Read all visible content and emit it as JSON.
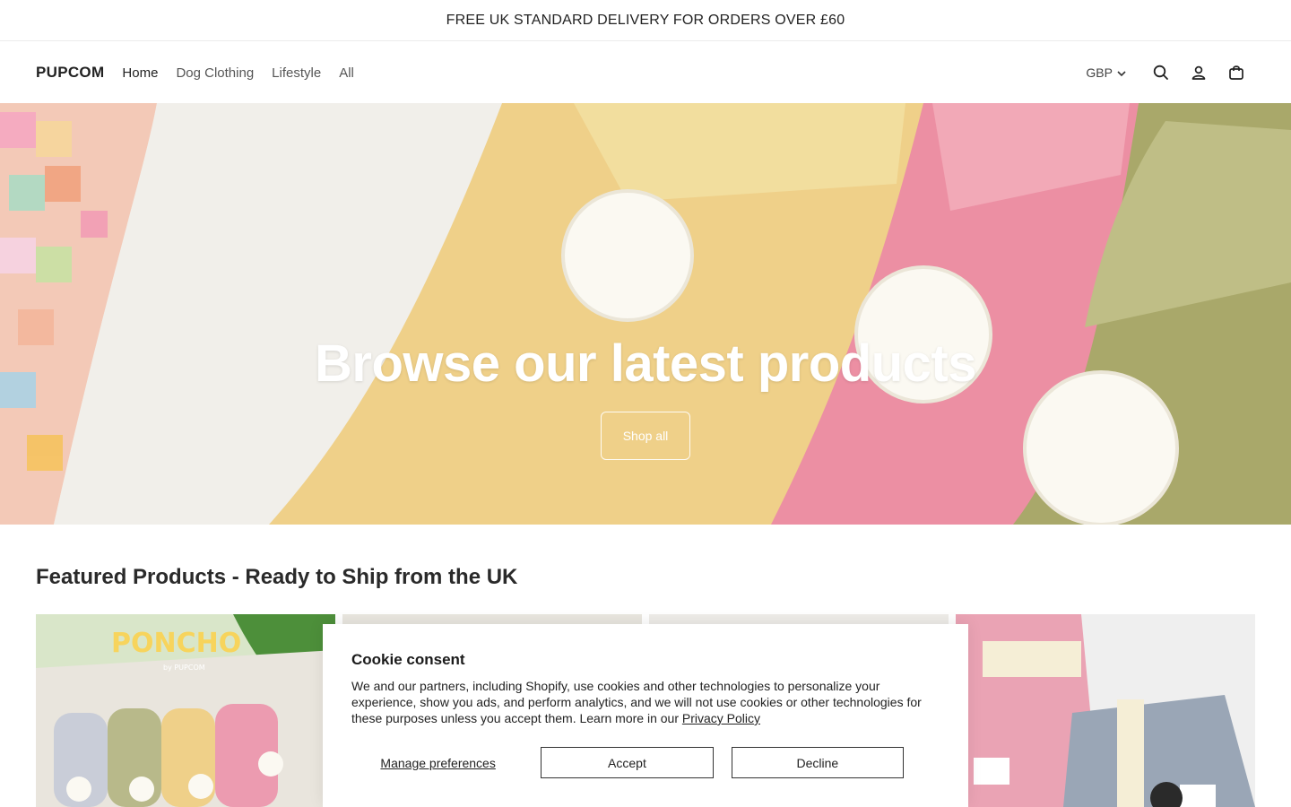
{
  "announcement": "FREE UK STANDARD DELIVERY FOR ORDERS OVER £60",
  "header": {
    "logo": "PUPCOM",
    "nav": [
      "Home",
      "Dog Clothing",
      "Lifestyle",
      "All"
    ],
    "currency": "GBP",
    "icons": [
      "search-icon",
      "account-icon",
      "cart-icon"
    ]
  },
  "hero": {
    "title": "Browse our latest products",
    "button": "Shop all"
  },
  "featured": {
    "title": "Featured Products - Ready to Ship from the UK",
    "product_images": [
      {
        "alt": "Poncho by Pupcom knitted scarves",
        "label_logo": "PONCHO",
        "label_small": "by PUPCOM"
      },
      {
        "alt": "product image"
      },
      {
        "alt": "product image"
      },
      {
        "alt": "Pupcom striped knit tops"
      }
    ]
  },
  "cookie": {
    "title": "Cookie consent",
    "body": "We and our partners, including Shopify, use cookies and other technologies to personalize your experience, show you ads, and perform analytics, and we will not use cookies or other technologies for these purposes unless you accept them. Learn more in our ",
    "link": "Privacy Policy",
    "manage": "Manage preferences",
    "accept": "Accept",
    "decline": "Decline"
  },
  "colors": {
    "text": "#222222",
    "hero_text": "#ffffff"
  }
}
